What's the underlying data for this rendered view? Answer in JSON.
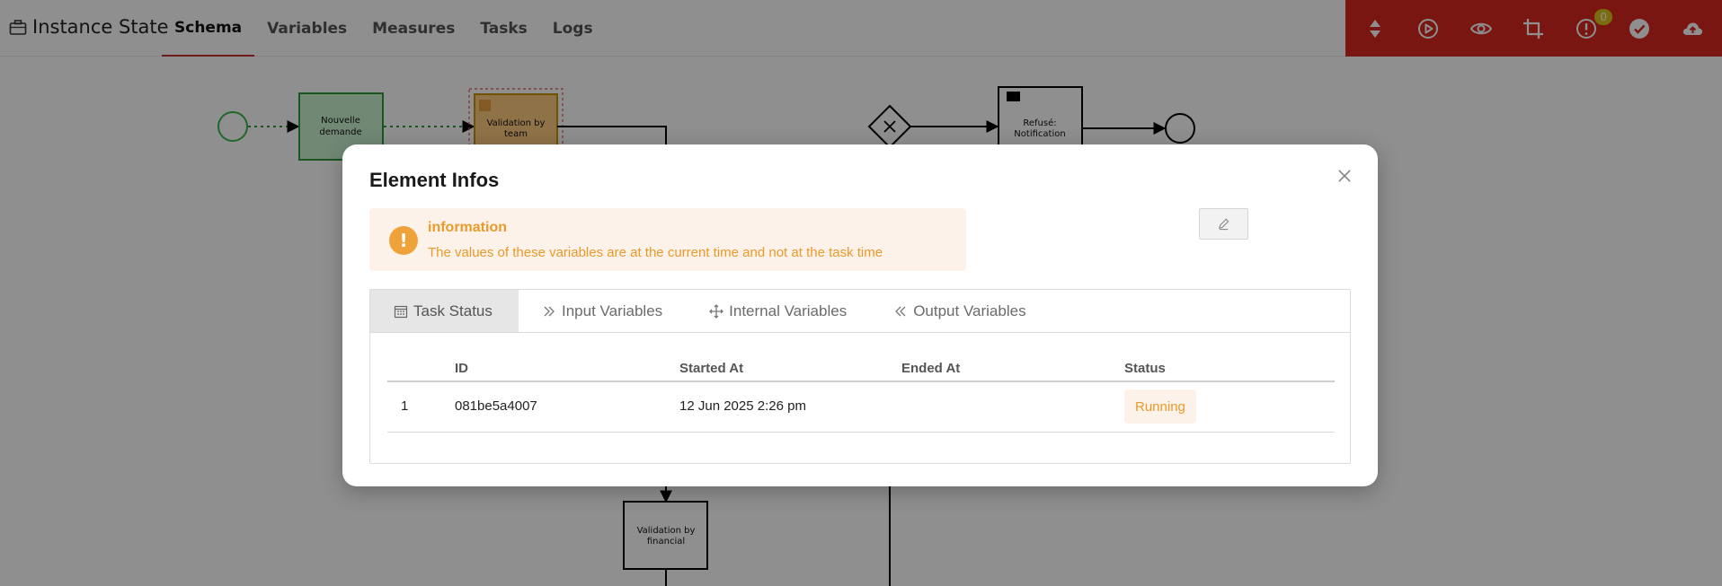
{
  "app": {
    "title": "Instance State"
  },
  "nav": {
    "tabs": [
      {
        "label": "Schema",
        "active": true
      },
      {
        "label": "Variables",
        "active": false
      },
      {
        "label": "Measures",
        "active": false
      },
      {
        "label": "Tasks",
        "active": false
      },
      {
        "label": "Logs",
        "active": false
      }
    ]
  },
  "toolbar": {
    "accent": "#d8281f",
    "icons": [
      "sort-icon",
      "play-icon",
      "eye-icon",
      "crop-icon",
      "alert-icon",
      "check-icon",
      "cloud-upload-icon"
    ],
    "alert_count": "0"
  },
  "diagram": {
    "tasks": {
      "nouvelle_demande": [
        "Nouvelle",
        "demande"
      ],
      "validation_team": [
        "Validation by",
        "team"
      ],
      "refuse_notification": [
        "Refusé:",
        "Notification"
      ],
      "validation_financial": [
        "Validation by",
        "financial"
      ]
    }
  },
  "modal": {
    "title": "Element Infos",
    "alert": {
      "title": "information",
      "text": "The values of these variables are at the current time and not at the task time",
      "icon_symbol": "!"
    },
    "tabs": [
      {
        "label": "Task Status",
        "icon": "calendar-icon",
        "active": true
      },
      {
        "label": "Input Variables",
        "icon": "double-chevron-right-icon",
        "active": false
      },
      {
        "label": "Internal Variables",
        "icon": "move-icon",
        "active": false
      },
      {
        "label": "Output Variables",
        "icon": "double-chevron-left-icon",
        "active": false
      }
    ],
    "table": {
      "headers": [
        "",
        "ID",
        "Started At",
        "Ended At",
        "Status"
      ],
      "rows": [
        {
          "index": "1",
          "id": "081be5a4007",
          "started_at": "12 Jun 2025 2:26 pm",
          "ended_at": "",
          "status": "Running"
        }
      ]
    },
    "colors": {
      "warning": "#e99a2b",
      "warning_bg": "#fdf2e9"
    }
  }
}
